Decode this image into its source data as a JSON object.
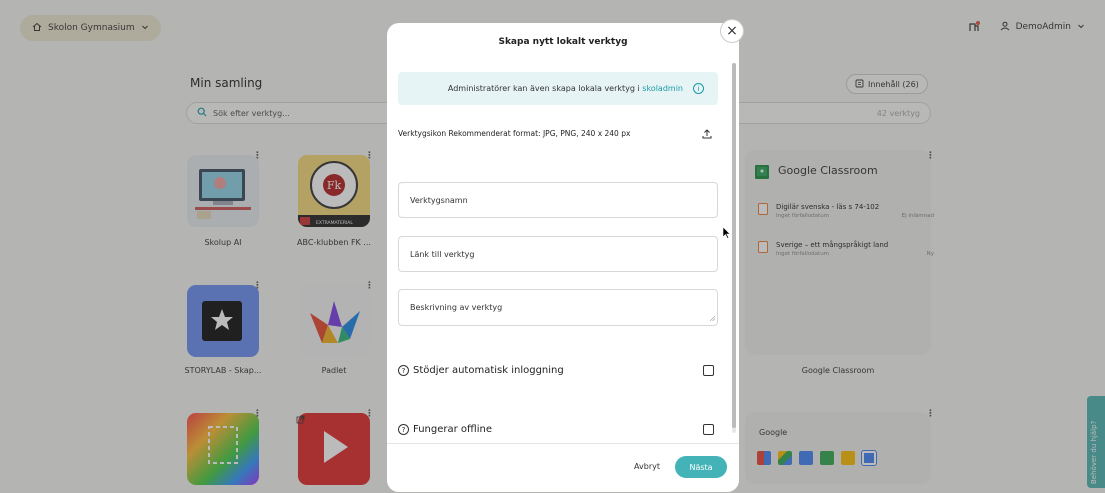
{
  "header": {
    "school_name": "Skolon Gymnasium",
    "user_name": "DemoAdmin"
  },
  "collection": {
    "title": "Min samling",
    "search_placeholder": "Sök efter verktyg...",
    "tool_count": "42 verktyg",
    "content_button": "Innehåll (26)",
    "tiles": [
      {
        "label": "Skolup AI"
      },
      {
        "label": "ABC-klubben FK ..."
      },
      {
        "label": "STORYLAB - Skap..."
      },
      {
        "label": "Padlet"
      }
    ],
    "abc_badge": "EXTRAMATERIAL",
    "google_classroom": {
      "title": "Google Classroom",
      "label": "Google Classroom",
      "items": [
        {
          "title": "Digilär svenska - läs s 74-102",
          "due": "Inget förfallodatum",
          "status": "Ej inlämnad"
        },
        {
          "title": "Sverige – ett mångspråkigt land",
          "due": "Inget förfallodatum",
          "status": "Ny"
        }
      ]
    },
    "google": {
      "title": "Google"
    }
  },
  "modal": {
    "title": "Skapa nytt lokalt verktyg",
    "info_text": "Administratörer kan även skapa lokala verktyg i",
    "info_link": "skoladmin",
    "icon_label": "Verktygsikon Rekommenderat format: JPG, PNG, 240 x 240 px",
    "name_placeholder": "Verktygsnamn",
    "link_placeholder": "Länk till verktyg",
    "description_placeholder": "Beskrivning av verktyg",
    "auto_login_label": "Stödjer automatisk inloggning",
    "offline_label": "Fungerar offline",
    "cancel_label": "Avbryt",
    "next_label": "Nästa"
  },
  "help_tab": "Behöver du hjälp?",
  "colors": {
    "accent": "#43b3b8",
    "info_bg": "#e7f4f6",
    "link": "#1a9aa7"
  }
}
